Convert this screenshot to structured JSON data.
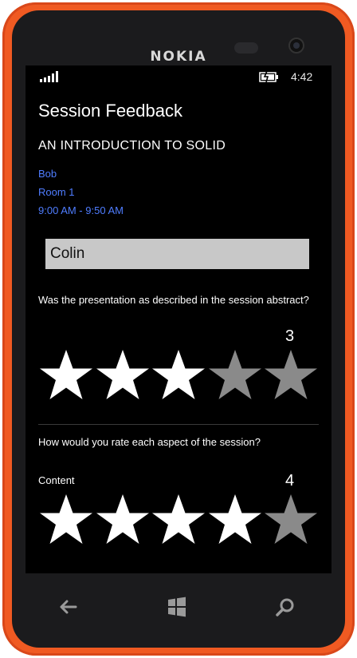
{
  "device": {
    "brand": "NOKIA"
  },
  "status_bar": {
    "time": "4:42",
    "signal_icon": "signal-icon",
    "battery_icon": "battery-charging-icon"
  },
  "page": {
    "title": "Session Feedback",
    "session_name": "AN INTRODUCTION TO SOLID",
    "speaker": "Bob",
    "room": "Room 1",
    "time": "9:00 AM - 9:50 AM"
  },
  "name_field": {
    "value": "Colin",
    "placeholder": ""
  },
  "question1": {
    "text": "Was the presentation as described in the session abstract?",
    "rating": "3",
    "max": 5
  },
  "question2": {
    "text": "How would you rate each aspect of the session?"
  },
  "content_rating": {
    "label": "Content",
    "rating": "4",
    "max": 5
  },
  "colors": {
    "accent": "#4f7dff",
    "star_filled": "#ffffff",
    "star_empty": "#8a8a8a",
    "phone": "#f05a22"
  },
  "navbar": {
    "icons": [
      "back-arrow-icon",
      "windows-start-icon",
      "search-icon"
    ]
  }
}
